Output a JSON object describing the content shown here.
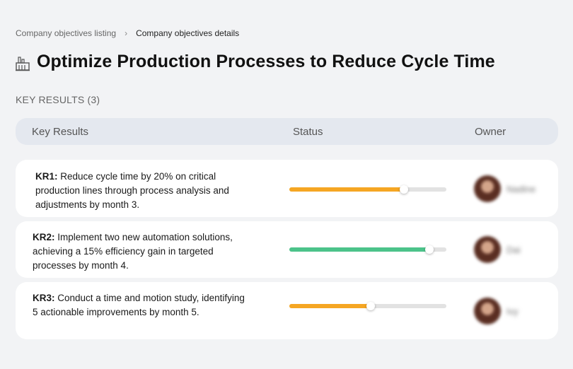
{
  "breadcrumb": {
    "parent": "Company objectives listing",
    "current": "Company objectives details"
  },
  "objective": {
    "icon": "factory-icon",
    "title": "Optimize Production Processes to Reduce Cycle Time"
  },
  "key_results_heading": "KEY RESULTS (3)",
  "table_headers": {
    "key_results": "Key Results",
    "status": "Status",
    "owner": "Owner"
  },
  "key_results": [
    {
      "id": "KR1:",
      "text": " Reduce cycle time by 20% on critical production lines through process analysis and adjustments by month 3.",
      "progress": 0.73,
      "color": "#f5a623",
      "owner": "Nadine"
    },
    {
      "id": "KR2:",
      "text": " Implement two new automation solutions, achieving a 15% efficiency gain in targeted processes by month 4.",
      "progress": 0.89,
      "color": "#4cc38a",
      "owner": "Dai"
    },
    {
      "id": "KR3:",
      "text": " Conduct a time and motion study, identifying 5 actionable improvements by month 5.",
      "progress": 0.52,
      "color": "#f5a623",
      "owner": "Ivy"
    }
  ]
}
